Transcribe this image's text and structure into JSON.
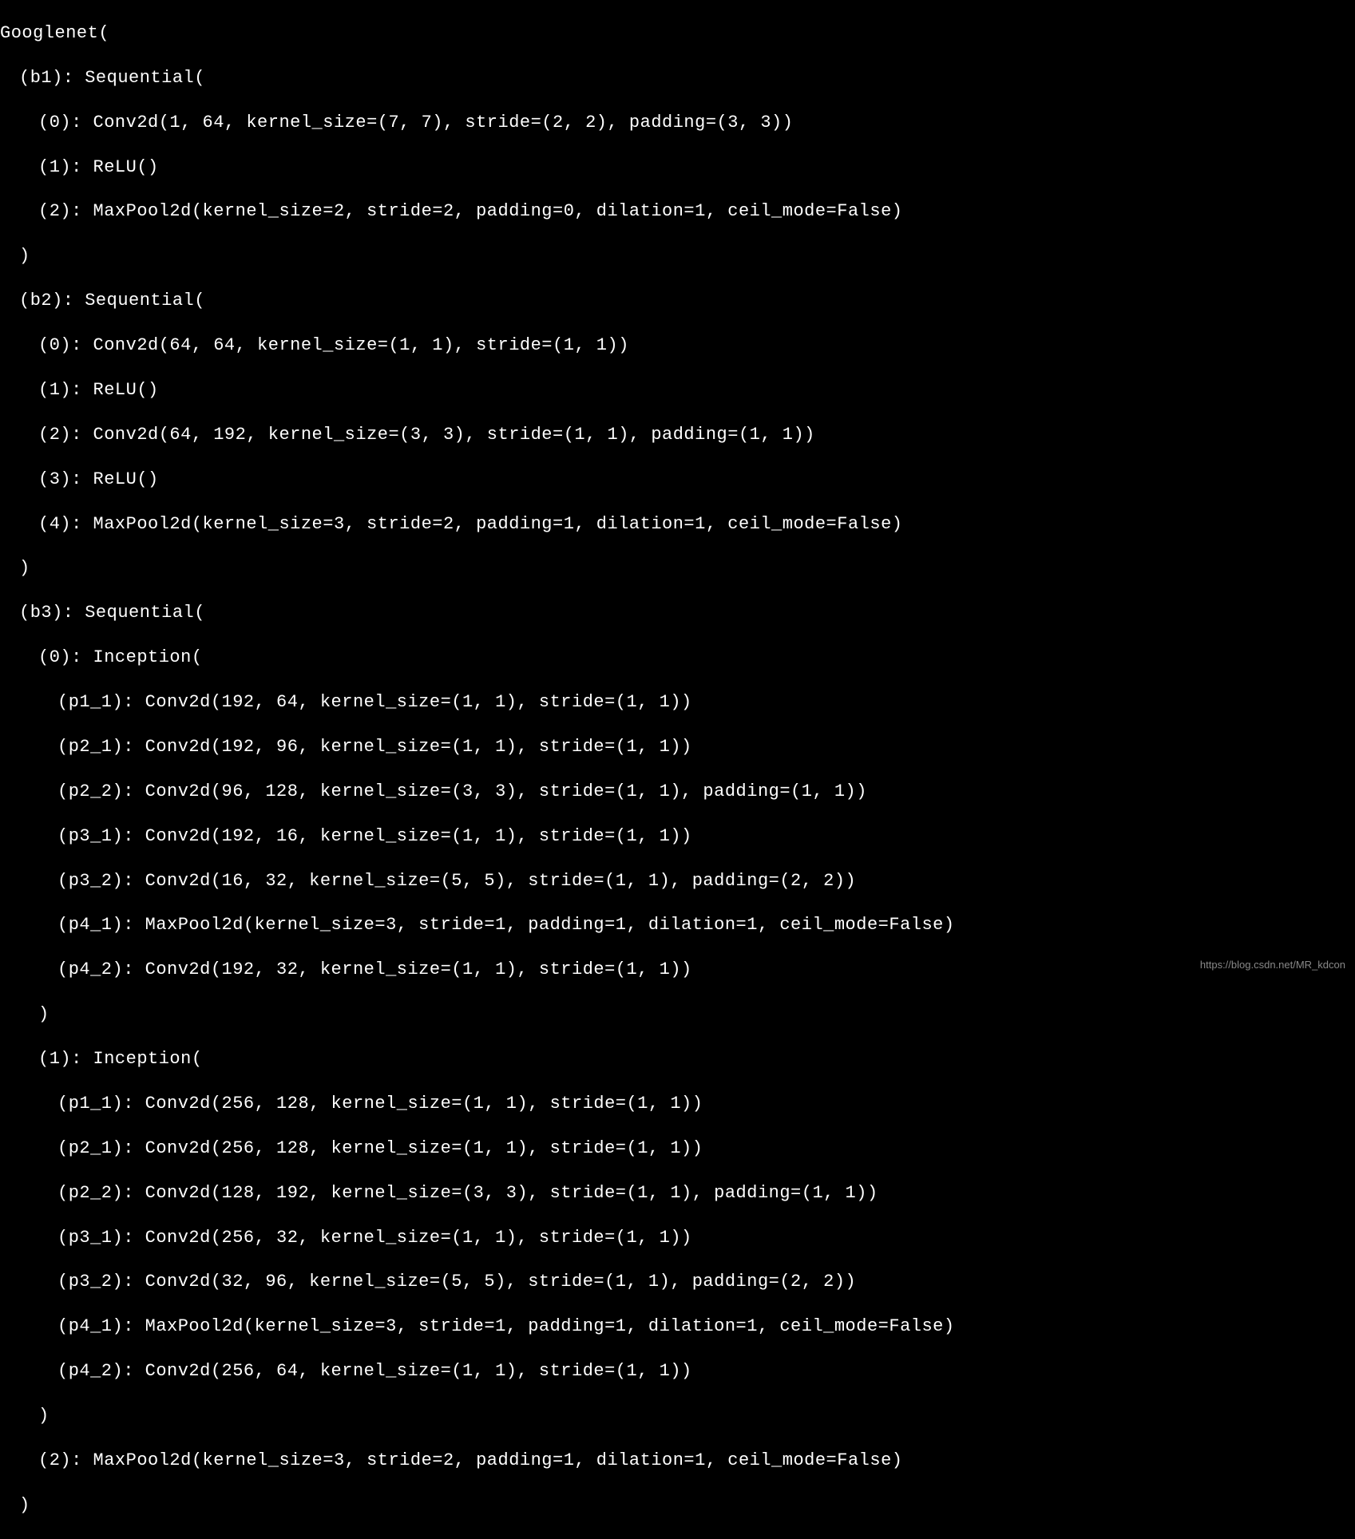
{
  "model_name": "Googlenet(",
  "b1": {
    "header": "(b1): Sequential(",
    "layers": [
      "(0): Conv2d(1, 64, kernel_size=(7, 7), stride=(2, 2), padding=(3, 3))",
      "(1): ReLU()",
      "(2): MaxPool2d(kernel_size=2, stride=2, padding=0, dilation=1, ceil_mode=False)"
    ],
    "close": ")"
  },
  "b2": {
    "header": "(b2): Sequential(",
    "layers": [
      "(0): Conv2d(64, 64, kernel_size=(1, 1), stride=(1, 1))",
      "(1): ReLU()",
      "(2): Conv2d(64, 192, kernel_size=(3, 3), stride=(1, 1), padding=(1, 1))",
      "(3): ReLU()",
      "(4): MaxPool2d(kernel_size=3, stride=2, padding=1, dilation=1, ceil_mode=False)"
    ],
    "close": ")"
  },
  "b3": {
    "header": "(b3): Sequential(",
    "inception0": {
      "header": "(0): Inception(",
      "layers": [
        "(p1_1): Conv2d(192, 64, kernel_size=(1, 1), stride=(1, 1))",
        "(p2_1): Conv2d(192, 96, kernel_size=(1, 1), stride=(1, 1))",
        "(p2_2): Conv2d(96, 128, kernel_size=(3, 3), stride=(1, 1), padding=(1, 1))",
        "(p3_1): Conv2d(192, 16, kernel_size=(1, 1), stride=(1, 1))",
        "(p3_2): Conv2d(16, 32, kernel_size=(5, 5), stride=(1, 1), padding=(2, 2))",
        "(p4_1): MaxPool2d(kernel_size=3, stride=1, padding=1, dilation=1, ceil_mode=False)",
        "(p4_2): Conv2d(192, 32, kernel_size=(1, 1), stride=(1, 1))"
      ],
      "close": ")"
    },
    "inception1": {
      "header": "(1): Inception(",
      "layers": [
        "(p1_1): Conv2d(256, 128, kernel_size=(1, 1), stride=(1, 1))",
        "(p2_1): Conv2d(256, 128, kernel_size=(1, 1), stride=(1, 1))",
        "(p2_2): Conv2d(128, 192, kernel_size=(3, 3), stride=(1, 1), padding=(1, 1))",
        "(p3_1): Conv2d(256, 32, kernel_size=(1, 1), stride=(1, 1))",
        "(p3_2): Conv2d(32, 96, kernel_size=(5, 5), stride=(1, 1), padding=(2, 2))",
        "(p4_1): MaxPool2d(kernel_size=3, stride=1, padding=1, dilation=1, ceil_mode=False)",
        "(p4_2): Conv2d(256, 64, kernel_size=(1, 1), stride=(1, 1))"
      ],
      "close": ")"
    },
    "maxpool": "(2): MaxPool2d(kernel_size=3, stride=2, padding=1, dilation=1, ceil_mode=False)",
    "close": ")"
  },
  "watermark": "https://blog.csdn.net/MR_kdcon"
}
